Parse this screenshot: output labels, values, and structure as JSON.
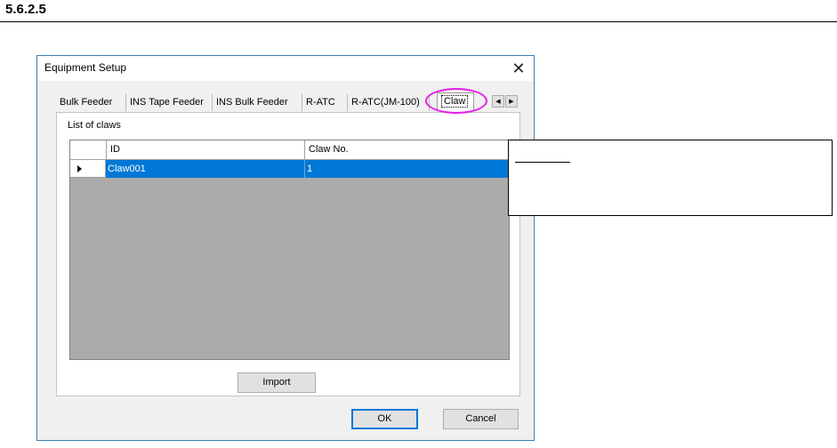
{
  "section": {
    "heading": "5.6.2.5"
  },
  "dialog": {
    "title": "Equipment Setup",
    "close_glyph": "✕",
    "tabs": [
      {
        "label": "Bulk Feeder"
      },
      {
        "label": "INS Tape Feeder"
      },
      {
        "label": "INS Bulk Feeder"
      },
      {
        "label": "R-ATC"
      },
      {
        "label": "R-ATC(JM-100)"
      },
      {
        "label": "Claw",
        "active": true
      }
    ],
    "tab_scroll": {
      "left_glyph": "◀",
      "right_glyph": "▶"
    },
    "list_label": "List of claws",
    "grid": {
      "columns": [
        "ID",
        "Claw No."
      ],
      "rows": [
        {
          "id": "Claw001",
          "claw_no": "1",
          "selected": true
        }
      ]
    },
    "import_button": "Import",
    "ok_button": "OK",
    "cancel_button": "Cancel"
  },
  "colors": {
    "selection": "#0078d7",
    "highlight_ellipse": "#e61ee6",
    "grid_empty": "#ababab"
  }
}
